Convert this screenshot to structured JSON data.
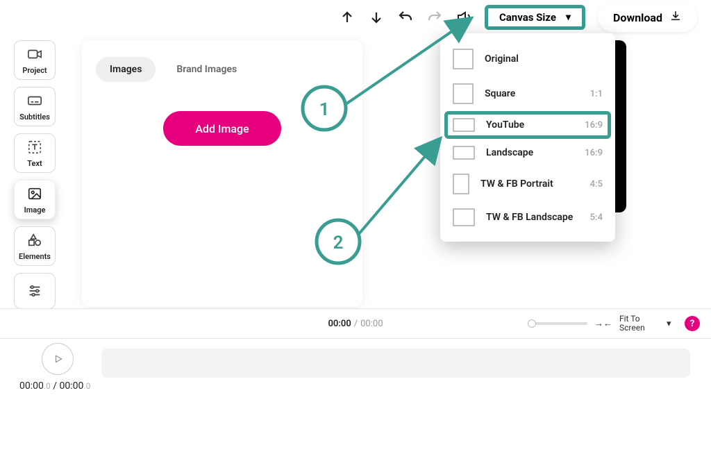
{
  "topbar": {
    "canvas_size_label": "Canvas Size",
    "download_label": "Download"
  },
  "rail": {
    "items": [
      {
        "label": "Project",
        "icon": "video-camera"
      },
      {
        "label": "Subtitles",
        "icon": "subtitles"
      },
      {
        "label": "Text",
        "icon": "text-t"
      },
      {
        "label": "Image",
        "icon": "image",
        "active": true
      },
      {
        "label": "Elements",
        "icon": "shapes"
      },
      {
        "label": "",
        "icon": "sliders"
      }
    ]
  },
  "image_panel": {
    "tabs": [
      {
        "label": "Images",
        "active": true
      },
      {
        "label": "Brand Images",
        "active": false
      }
    ],
    "add_button": "Add Image"
  },
  "canvas_dropdown": {
    "items": [
      {
        "label": "Original",
        "ratio": ""
      },
      {
        "label": "Square",
        "ratio": "1:1"
      },
      {
        "label": "YouTube",
        "ratio": "16:9",
        "highlight": true
      },
      {
        "label": "Landscape",
        "ratio": "16:9"
      },
      {
        "label": "TW & FB Portrait",
        "ratio": "4:5"
      },
      {
        "label": "TW & FB Landscape",
        "ratio": "5:4"
      }
    ]
  },
  "annotations": {
    "step1": "1",
    "step2": "2"
  },
  "playbar": {
    "current": "00:00",
    "separator": "/",
    "total": "00:00",
    "fit_label": "Fit To Screen",
    "help": "?"
  },
  "timeline": {
    "current": "00:00",
    "current_sub": ".0",
    "separator": "/",
    "total": "00:00",
    "total_sub": ".0"
  },
  "colors": {
    "accent_teal": "#3a9d92",
    "accent_pink": "#e6007e"
  }
}
